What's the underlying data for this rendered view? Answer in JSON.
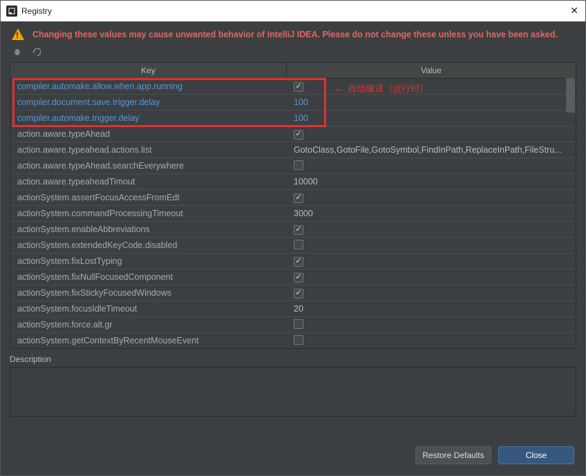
{
  "window": {
    "title": "Registry"
  },
  "warning": "Changing these values may cause unwanted behavior of IntelliJ IDEA. Please do not change these unless you have been asked.",
  "columns": {
    "key": "Key",
    "value": "Value"
  },
  "annotation": "自动编译（运行时）",
  "rows": [
    {
      "key": "compiler.automake.allow.when.app.running",
      "type": "check",
      "checked": true,
      "highlight": true
    },
    {
      "key": "compiler.document.save.trigger.delay",
      "type": "text",
      "value": "100",
      "highlight": true
    },
    {
      "key": "compiler.automake.trigger.delay",
      "type": "text",
      "value": "100",
      "highlight": true
    },
    {
      "key": "action.aware.typeAhead",
      "type": "check",
      "checked": true
    },
    {
      "key": "action.aware.typeahead.actions.list",
      "type": "text",
      "value": "GotoClass,GotoFile,GotoSymbol,FindInPath,ReplaceInPath,FileStru..."
    },
    {
      "key": "action.aware.typeAhead.searchEverywhere",
      "type": "check",
      "checked": false
    },
    {
      "key": "action.aware.typeaheadTimout",
      "type": "text",
      "value": "10000"
    },
    {
      "key": "actionSystem.assertFocusAccessFromEdt",
      "type": "check",
      "checked": true
    },
    {
      "key": "actionSystem.commandProcessingTimeout",
      "type": "text",
      "value": "3000"
    },
    {
      "key": "actionSystem.enableAbbreviations",
      "type": "check",
      "checked": true
    },
    {
      "key": "actionSystem.extendedKeyCode.disabled",
      "type": "check",
      "checked": false
    },
    {
      "key": "actionSystem.fixLostTyping",
      "type": "check",
      "checked": true
    },
    {
      "key": "actionSystem.fixNullFocusedComponent",
      "type": "check",
      "checked": true
    },
    {
      "key": "actionSystem.fixStickyFocusedWindows",
      "type": "check",
      "checked": true
    },
    {
      "key": "actionSystem.focusIdleTimeout",
      "type": "text",
      "value": "20"
    },
    {
      "key": "actionSystem.force.alt.gr",
      "type": "check",
      "checked": false
    },
    {
      "key": "actionSystem.getContextByRecentMouseEvent",
      "type": "check",
      "checked": false
    }
  ],
  "description_label": "Description",
  "buttons": {
    "restore": "Restore Defaults",
    "close": "Close"
  }
}
